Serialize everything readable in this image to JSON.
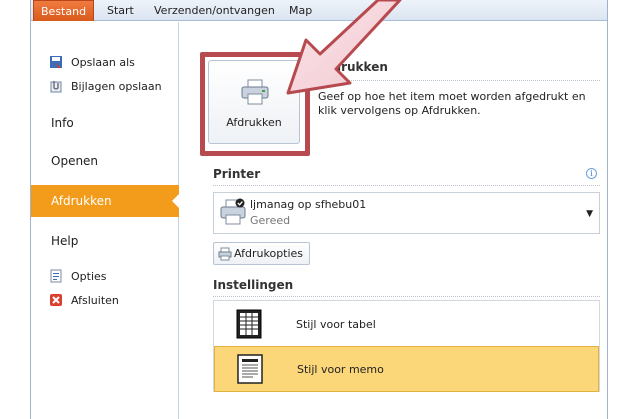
{
  "tabs": [
    {
      "label": "Bestand",
      "active": true
    },
    {
      "label": "Start"
    },
    {
      "label": "Verzenden/ontvangen"
    },
    {
      "label": "Map"
    }
  ],
  "nav": {
    "save_as": "Opslaan als",
    "save_attachments": "Bijlagen opslaan",
    "info": "Info",
    "open": "Openen",
    "print": "Afdrukken",
    "help": "Help",
    "options": "Opties",
    "exit": "Afsluiten"
  },
  "print_section": {
    "title": "Afdrukken",
    "button_label": "Afdrukken",
    "description": "Geef op hoe het item moet worden afgedrukt en klik vervolgens op Afdrukken."
  },
  "printer_section": {
    "title": "Printer",
    "printer_name": "ljmanag op sfhebu01",
    "printer_status": "Gereed",
    "properties_label": "Afdrukopties"
  },
  "settings_section": {
    "title": "Instellingen",
    "styles": [
      {
        "label": "Stijl voor tabel",
        "selected": false
      },
      {
        "label": "Stijl voor memo",
        "selected": true
      }
    ]
  },
  "colors": {
    "accent_orange": "#f39c1c",
    "file_tab": "#e4662a",
    "callout": "#b74a4f"
  }
}
